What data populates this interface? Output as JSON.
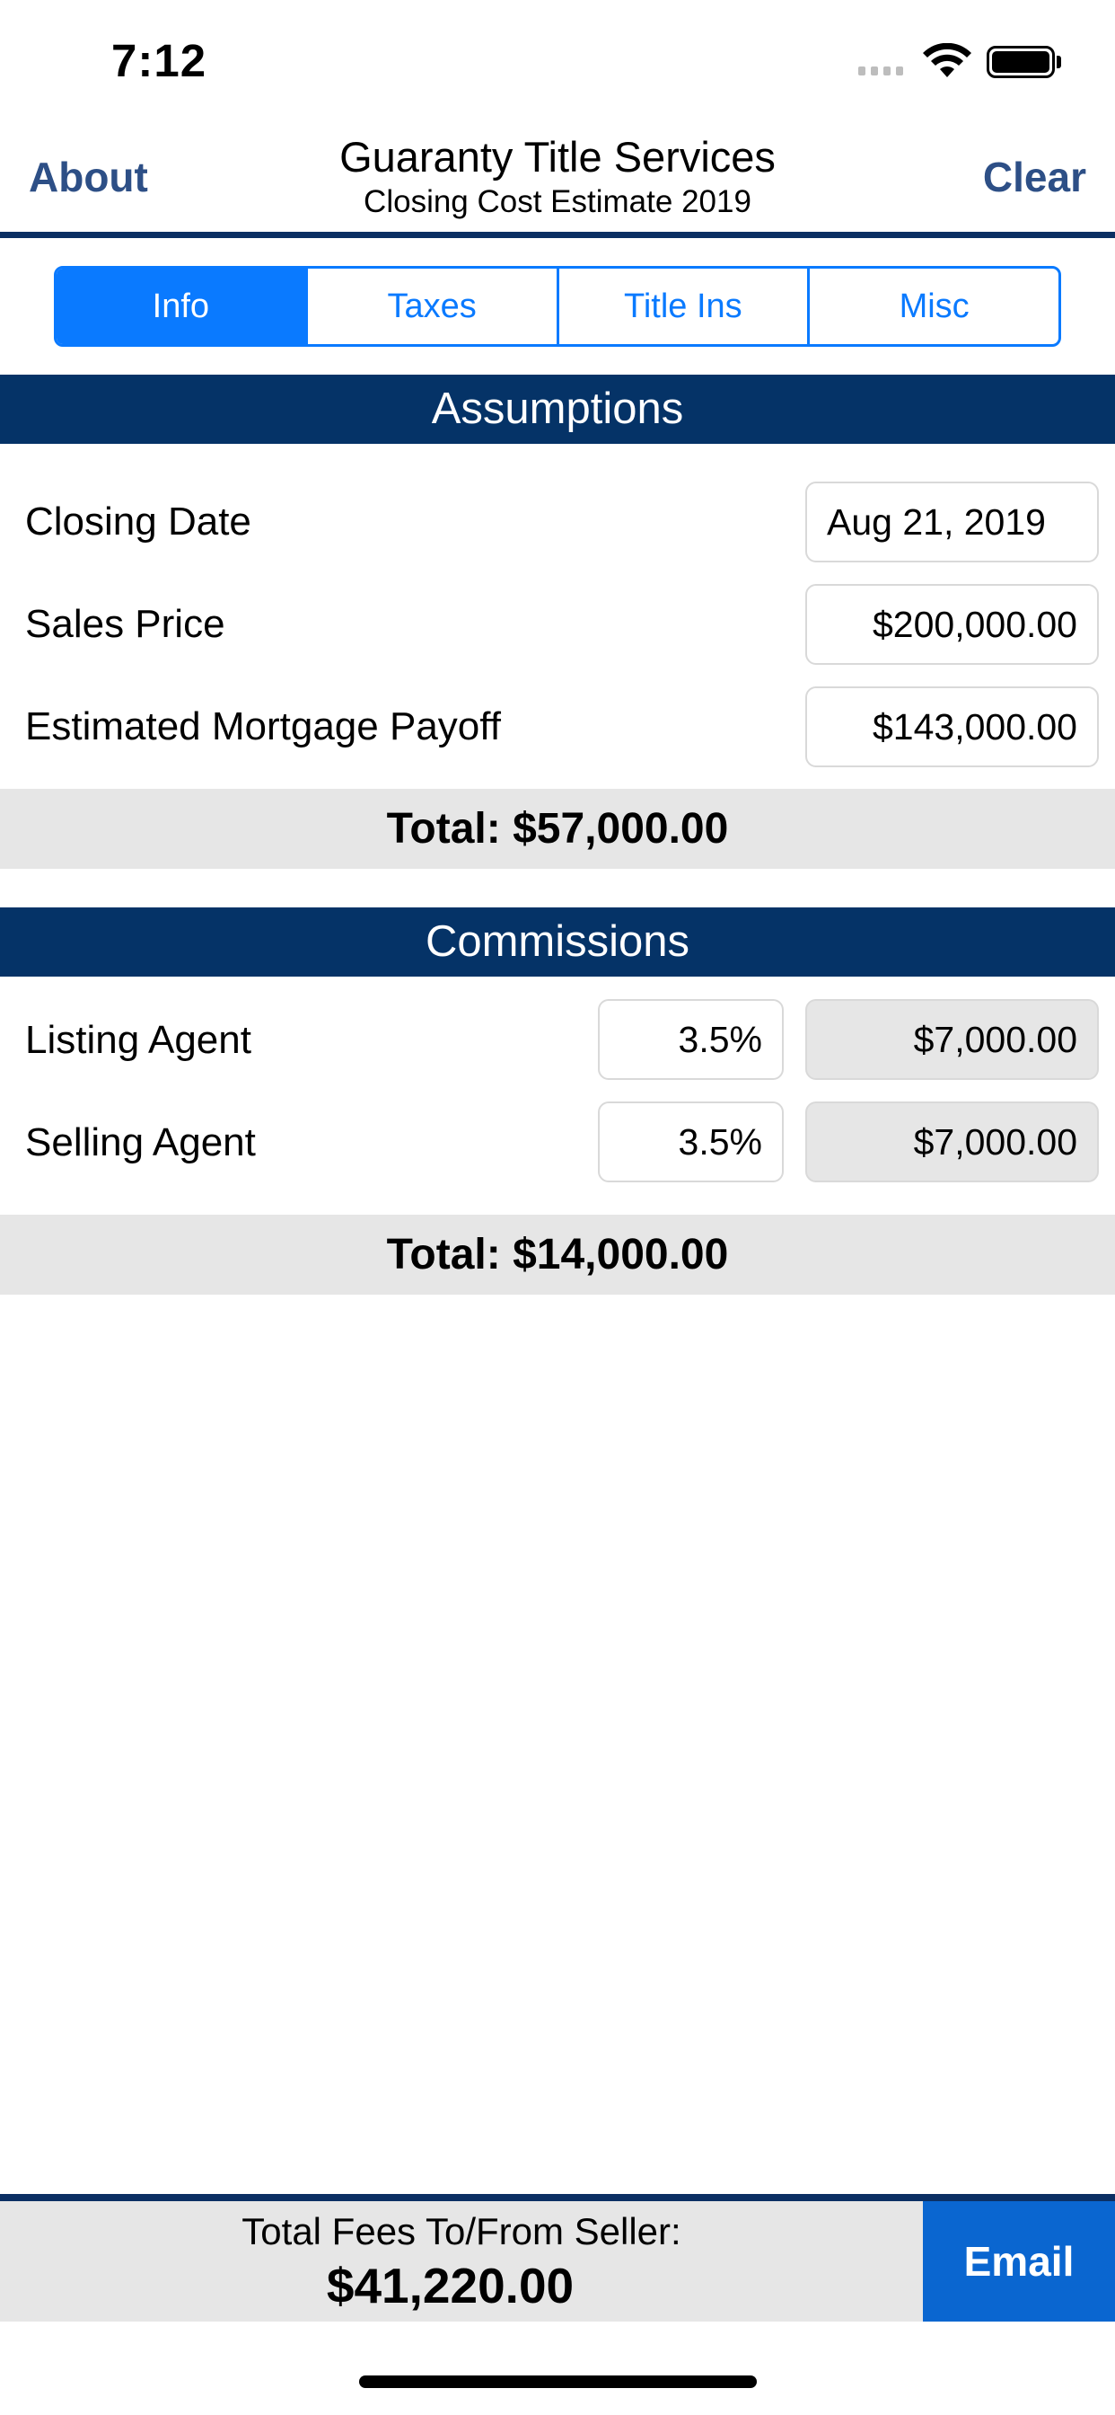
{
  "status_bar": {
    "time": "7:12"
  },
  "nav": {
    "left_label": "About",
    "title": "Guaranty Title Services",
    "subtitle": "Closing Cost Estimate 2019",
    "right_label": "Clear"
  },
  "tabs": [
    {
      "label": "Info",
      "active": true
    },
    {
      "label": "Taxes",
      "active": false
    },
    {
      "label": "Title Ins",
      "active": false
    },
    {
      "label": "Misc",
      "active": false
    }
  ],
  "assumptions": {
    "header": "Assumptions",
    "rows": [
      {
        "label": "Closing Date",
        "value": "Aug 21, 2019"
      },
      {
        "label": "Sales Price",
        "value": "$200,000.00"
      },
      {
        "label": "Estimated Mortgage Payoff",
        "value": "$143,000.00"
      }
    ],
    "total": "Total:  $57,000.00"
  },
  "commissions": {
    "header": "Commissions",
    "rows": [
      {
        "label": "Listing Agent",
        "percent": "3.5%",
        "amount": "$7,000.00"
      },
      {
        "label": "Selling Agent",
        "percent": "3.5%",
        "amount": "$7,000.00"
      }
    ],
    "total": "Total:  $14,000.00"
  },
  "footer": {
    "label": "Total Fees To/From Seller:",
    "value": "$41,220.00",
    "email_label": "Email"
  },
  "colors": {
    "navy": "#053367",
    "accent": "#0a7aff",
    "email_button": "#0a66d0"
  }
}
